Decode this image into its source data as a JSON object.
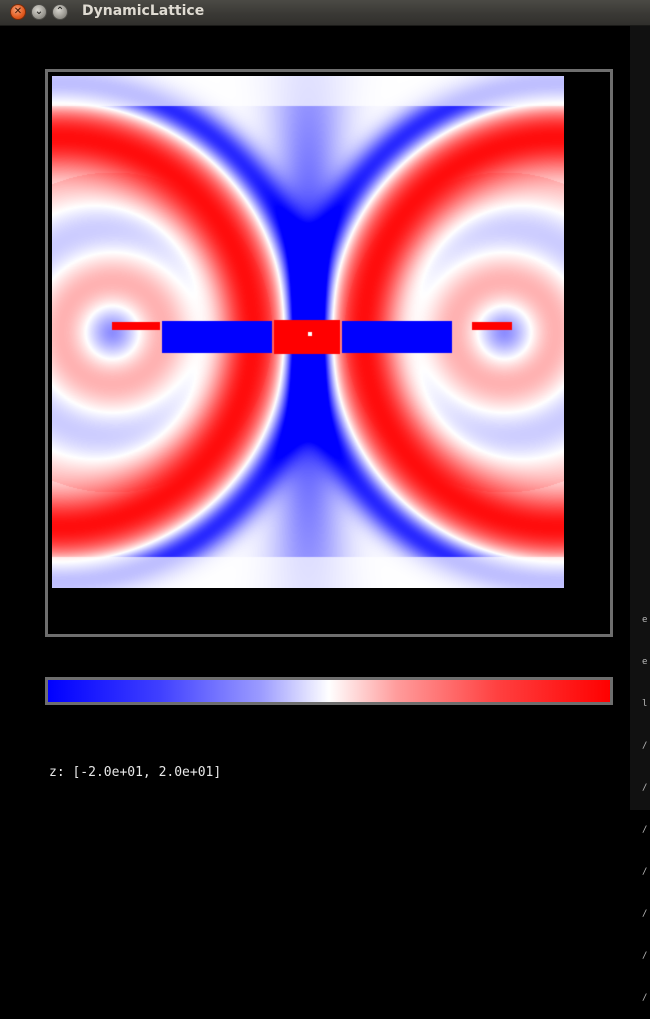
{
  "window": {
    "title": "DynamicLattice",
    "buttons": {
      "close_glyph": "✕",
      "minimize_glyph": "⌄",
      "maximize_glyph": "⌃"
    }
  },
  "plot": {
    "field_kind": "symmetric two-source interference pattern",
    "colormap": [
      "#0000ff",
      "#ffffff",
      "#ff0000"
    ]
  },
  "colorbar": {
    "range_label": "z: [-2.0e+01, 2.0e+01]"
  },
  "side_strip": {
    "chars": [
      "e",
      "e",
      "l",
      "/",
      "/",
      "/",
      "/",
      "/",
      "/",
      "/"
    ]
  }
}
